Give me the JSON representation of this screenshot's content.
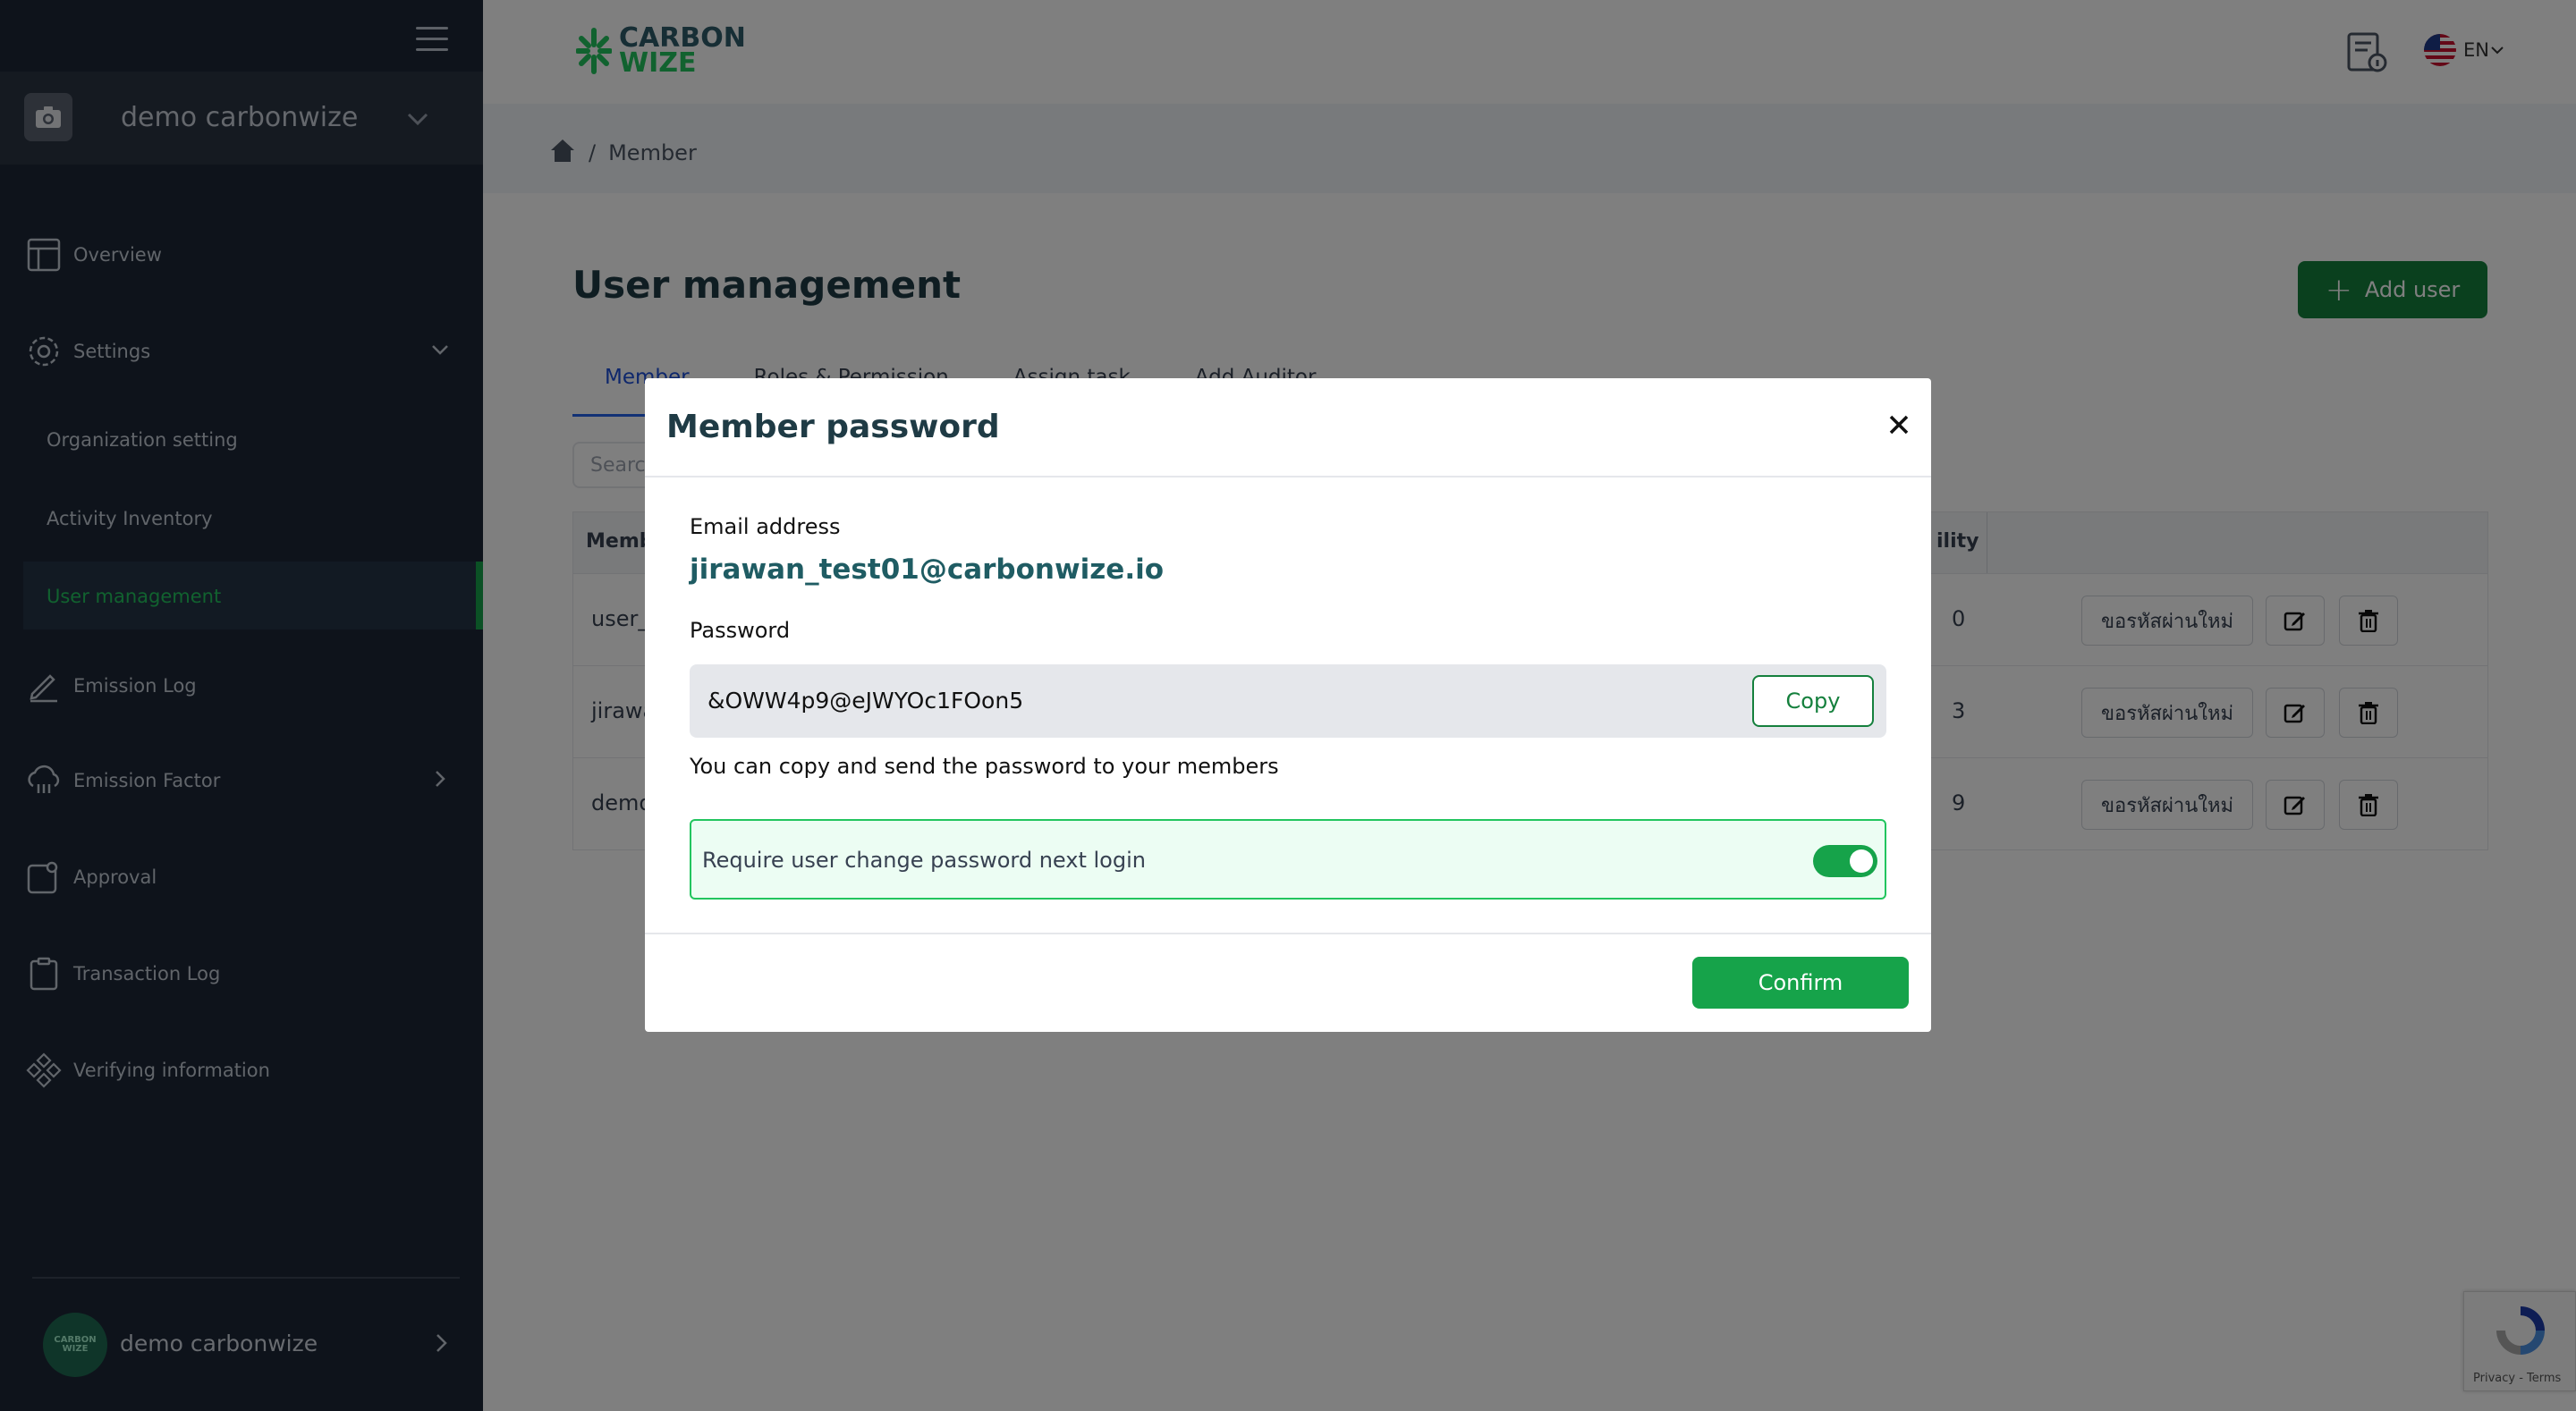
{
  "sidebar": {
    "org_name": "demo carbonwize",
    "nav": {
      "overview": "Overview",
      "settings": "Settings",
      "organization_setting": "Organization setting",
      "activity_inventory": "Activity Inventory",
      "user_management": "User management",
      "emission_log": "Emission Log",
      "emission_factor": "Emission Factor",
      "approval": "Approval",
      "transaction_log": "Transaction Log",
      "verifying_information": "Verifying information"
    },
    "user_name": "demo carbonwize",
    "avatar_text": "CARBON WIZE"
  },
  "header": {
    "logo_line1": "CARBON",
    "logo_line2": "WIZE",
    "language": "EN"
  },
  "breadcrumb": {
    "current": "Member",
    "separator": "/"
  },
  "page": {
    "title": "User management",
    "add_user_label": "Add user",
    "tabs": [
      "Member",
      "Roles & Permission",
      "Assign task",
      "Add Auditor"
    ],
    "search_placeholder": "Search"
  },
  "table": {
    "headers": [
      "Member",
      "ility"
    ],
    "rows": [
      {
        "name": "user_",
        "count": "0",
        "reset_label": "ขอรหัสผ่านใหม่"
      },
      {
        "name": "jirawa",
        "count": "3",
        "reset_label": "ขอรหัสผ่านใหม่"
      },
      {
        "name": "demo",
        "count": "9",
        "reset_label": "ขอรหัสผ่านใหม่"
      }
    ]
  },
  "modal": {
    "title": "Member password",
    "email_label": "Email address",
    "email_value": "jirawan_test01@carbonwize.io",
    "password_label": "Password",
    "password_value": "&OWW4p9@eJWYOc1FOon5",
    "copy_label": "Copy",
    "hint": "You can copy and send the password to your members",
    "require_change_label": "Require user change password next login",
    "require_change_enabled": true,
    "confirm_label": "Confirm"
  },
  "recaptcha": {
    "terms": "Privacy - Terms"
  },
  "colors": {
    "sidebar_bg": "#1c2736",
    "accent_green": "#16a34a",
    "title_teal": "#1f3b45",
    "tab_active": "#2563eb"
  }
}
